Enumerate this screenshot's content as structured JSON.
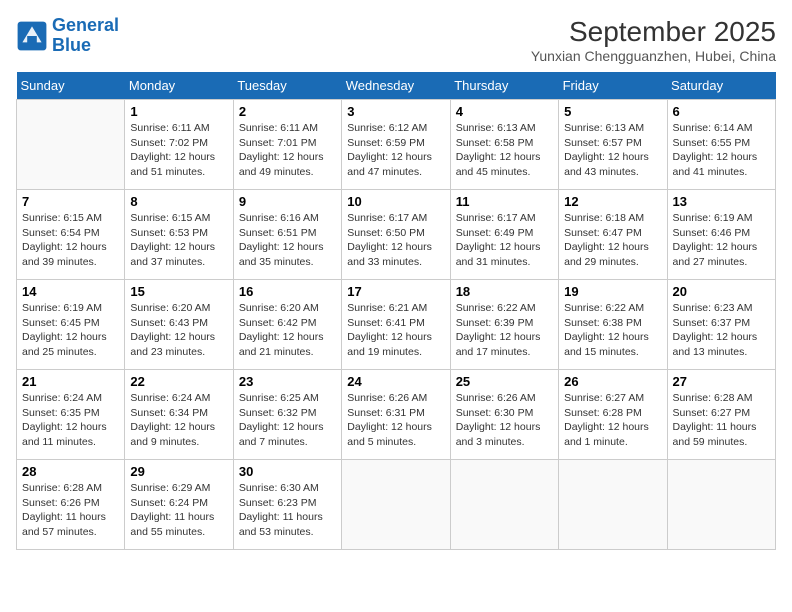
{
  "header": {
    "logo_line1": "General",
    "logo_line2": "Blue",
    "month": "September 2025",
    "location": "Yunxian Chengguanzhen, Hubei, China"
  },
  "weekdays": [
    "Sunday",
    "Monday",
    "Tuesday",
    "Wednesday",
    "Thursday",
    "Friday",
    "Saturday"
  ],
  "weeks": [
    [
      {
        "day": "",
        "info": ""
      },
      {
        "day": "1",
        "info": "Sunrise: 6:11 AM\nSunset: 7:02 PM\nDaylight: 12 hours\nand 51 minutes."
      },
      {
        "day": "2",
        "info": "Sunrise: 6:11 AM\nSunset: 7:01 PM\nDaylight: 12 hours\nand 49 minutes."
      },
      {
        "day": "3",
        "info": "Sunrise: 6:12 AM\nSunset: 6:59 PM\nDaylight: 12 hours\nand 47 minutes."
      },
      {
        "day": "4",
        "info": "Sunrise: 6:13 AM\nSunset: 6:58 PM\nDaylight: 12 hours\nand 45 minutes."
      },
      {
        "day": "5",
        "info": "Sunrise: 6:13 AM\nSunset: 6:57 PM\nDaylight: 12 hours\nand 43 minutes."
      },
      {
        "day": "6",
        "info": "Sunrise: 6:14 AM\nSunset: 6:55 PM\nDaylight: 12 hours\nand 41 minutes."
      }
    ],
    [
      {
        "day": "7",
        "info": "Sunrise: 6:15 AM\nSunset: 6:54 PM\nDaylight: 12 hours\nand 39 minutes."
      },
      {
        "day": "8",
        "info": "Sunrise: 6:15 AM\nSunset: 6:53 PM\nDaylight: 12 hours\nand 37 minutes."
      },
      {
        "day": "9",
        "info": "Sunrise: 6:16 AM\nSunset: 6:51 PM\nDaylight: 12 hours\nand 35 minutes."
      },
      {
        "day": "10",
        "info": "Sunrise: 6:17 AM\nSunset: 6:50 PM\nDaylight: 12 hours\nand 33 minutes."
      },
      {
        "day": "11",
        "info": "Sunrise: 6:17 AM\nSunset: 6:49 PM\nDaylight: 12 hours\nand 31 minutes."
      },
      {
        "day": "12",
        "info": "Sunrise: 6:18 AM\nSunset: 6:47 PM\nDaylight: 12 hours\nand 29 minutes."
      },
      {
        "day": "13",
        "info": "Sunrise: 6:19 AM\nSunset: 6:46 PM\nDaylight: 12 hours\nand 27 minutes."
      }
    ],
    [
      {
        "day": "14",
        "info": "Sunrise: 6:19 AM\nSunset: 6:45 PM\nDaylight: 12 hours\nand 25 minutes."
      },
      {
        "day": "15",
        "info": "Sunrise: 6:20 AM\nSunset: 6:43 PM\nDaylight: 12 hours\nand 23 minutes."
      },
      {
        "day": "16",
        "info": "Sunrise: 6:20 AM\nSunset: 6:42 PM\nDaylight: 12 hours\nand 21 minutes."
      },
      {
        "day": "17",
        "info": "Sunrise: 6:21 AM\nSunset: 6:41 PM\nDaylight: 12 hours\nand 19 minutes."
      },
      {
        "day": "18",
        "info": "Sunrise: 6:22 AM\nSunset: 6:39 PM\nDaylight: 12 hours\nand 17 minutes."
      },
      {
        "day": "19",
        "info": "Sunrise: 6:22 AM\nSunset: 6:38 PM\nDaylight: 12 hours\nand 15 minutes."
      },
      {
        "day": "20",
        "info": "Sunrise: 6:23 AM\nSunset: 6:37 PM\nDaylight: 12 hours\nand 13 minutes."
      }
    ],
    [
      {
        "day": "21",
        "info": "Sunrise: 6:24 AM\nSunset: 6:35 PM\nDaylight: 12 hours\nand 11 minutes."
      },
      {
        "day": "22",
        "info": "Sunrise: 6:24 AM\nSunset: 6:34 PM\nDaylight: 12 hours\nand 9 minutes."
      },
      {
        "day": "23",
        "info": "Sunrise: 6:25 AM\nSunset: 6:32 PM\nDaylight: 12 hours\nand 7 minutes."
      },
      {
        "day": "24",
        "info": "Sunrise: 6:26 AM\nSunset: 6:31 PM\nDaylight: 12 hours\nand 5 minutes."
      },
      {
        "day": "25",
        "info": "Sunrise: 6:26 AM\nSunset: 6:30 PM\nDaylight: 12 hours\nand 3 minutes."
      },
      {
        "day": "26",
        "info": "Sunrise: 6:27 AM\nSunset: 6:28 PM\nDaylight: 12 hours\nand 1 minute."
      },
      {
        "day": "27",
        "info": "Sunrise: 6:28 AM\nSunset: 6:27 PM\nDaylight: 11 hours\nand 59 minutes."
      }
    ],
    [
      {
        "day": "28",
        "info": "Sunrise: 6:28 AM\nSunset: 6:26 PM\nDaylight: 11 hours\nand 57 minutes."
      },
      {
        "day": "29",
        "info": "Sunrise: 6:29 AM\nSunset: 6:24 PM\nDaylight: 11 hours\nand 55 minutes."
      },
      {
        "day": "30",
        "info": "Sunrise: 6:30 AM\nSunset: 6:23 PM\nDaylight: 11 hours\nand 53 minutes."
      },
      {
        "day": "",
        "info": ""
      },
      {
        "day": "",
        "info": ""
      },
      {
        "day": "",
        "info": ""
      },
      {
        "day": "",
        "info": ""
      }
    ]
  ]
}
